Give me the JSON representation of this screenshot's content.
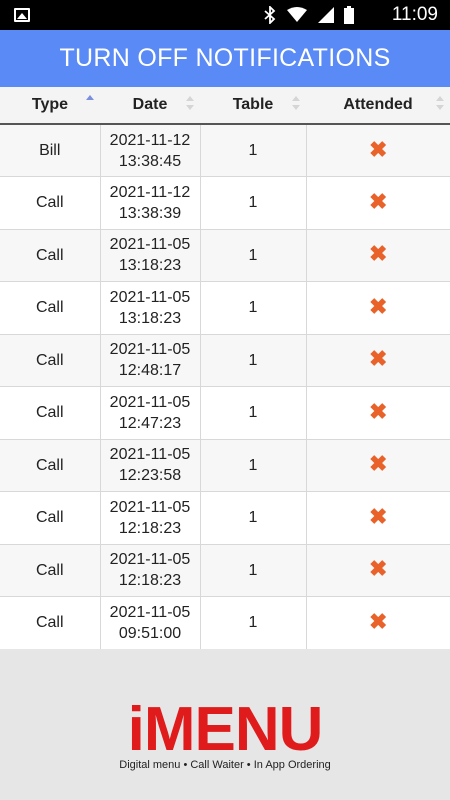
{
  "status_bar": {
    "time": "11:09",
    "icons": [
      "gallery-icon",
      "bluetooth-icon",
      "wifi-icon",
      "signal-icon",
      "battery-icon"
    ]
  },
  "title": "TURN OFF NOTIFICATIONS",
  "table": {
    "headers": [
      "Type",
      "Date",
      "Table",
      "Attended"
    ],
    "sort_column": "Type",
    "sort_direction": "ascending",
    "rows": [
      {
        "type": "Bill",
        "date": "2021-11-12",
        "time": "13:38:45",
        "table": "1",
        "attended": "✖"
      },
      {
        "type": "Call",
        "date": "2021-11-12",
        "time": "13:38:39",
        "table": "1",
        "attended": "✖"
      },
      {
        "type": "Call",
        "date": "2021-11-05",
        "time": "13:18:23",
        "table": "1",
        "attended": "✖"
      },
      {
        "type": "Call",
        "date": "2021-11-05",
        "time": "13:18:23",
        "table": "1",
        "attended": "✖"
      },
      {
        "type": "Call",
        "date": "2021-11-05",
        "time": "12:48:17",
        "table": "1",
        "attended": "✖"
      },
      {
        "type": "Call",
        "date": "2021-11-05",
        "time": "12:47:23",
        "table": "1",
        "attended": "✖"
      },
      {
        "type": "Call",
        "date": "2021-11-05",
        "time": "12:23:58",
        "table": "1",
        "attended": "✖"
      },
      {
        "type": "Call",
        "date": "2021-11-05",
        "time": "12:18:23",
        "table": "1",
        "attended": "✖"
      },
      {
        "type": "Call",
        "date": "2021-11-05",
        "time": "12:18:23",
        "table": "1",
        "attended": "✖"
      },
      {
        "type": "Call",
        "date": "2021-11-05",
        "time": "09:51:00",
        "table": "1",
        "attended": "✖"
      }
    ]
  },
  "footer": {
    "logo_text": "iMENU",
    "tagline": "Digital menu • Call Waiter • In App Ordering"
  },
  "colors": {
    "title_bar": "#5a8af5",
    "not_attended_mark": "#e8622a",
    "logo": "#e01b1b"
  }
}
